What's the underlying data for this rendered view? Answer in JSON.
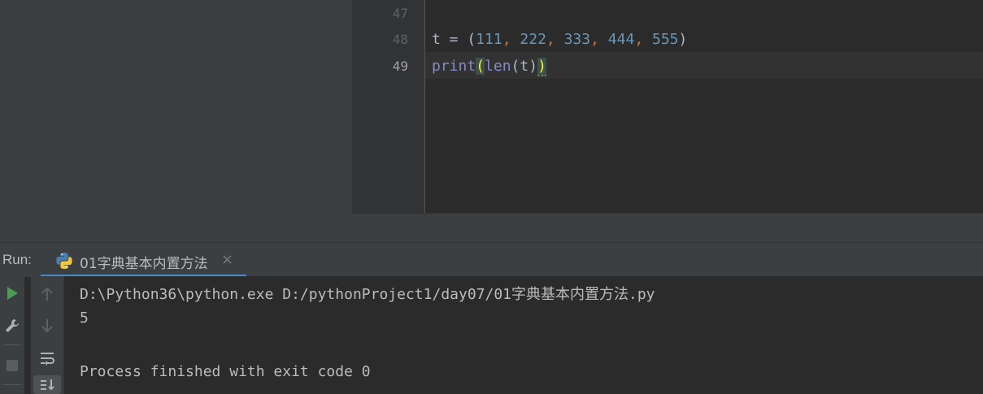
{
  "editor": {
    "lines": [
      {
        "num": "47",
        "code": ""
      },
      {
        "num": "48",
        "code": "t = (111, 222, 333, 444, 555)"
      },
      {
        "num": "49",
        "code": "print(len(t))"
      }
    ],
    "line48_tokens": {
      "var": "t = (",
      "n1": "111",
      "n2": "222",
      "n3": "333",
      "n4": "444",
      "n5": "555",
      "comma": ",",
      "close": ")"
    },
    "line49_tokens": {
      "print": "print",
      "open": "(",
      "len": "len",
      "inner": "(t)",
      "close": ")"
    }
  },
  "run_panel": {
    "label": "Run:",
    "tab_label": "01字典基本内置方法",
    "close": "×"
  },
  "console": {
    "lines": [
      "D:\\Python36\\python.exe D:/pythonProject1/day07/01字典基本内置方法.py",
      "5",
      "",
      "Process finished with exit code 0"
    ]
  },
  "icons": {
    "run": "play-icon",
    "wrench": "wrench-icon",
    "stop": "stop-icon",
    "up": "arrow-up-icon",
    "down": "arrow-down-icon",
    "wrap": "soft-wrap-icon",
    "scroll": "scroll-to-end-icon",
    "python": "python-icon"
  },
  "colors": {
    "accent": "#4a88c7",
    "number": "#6897bb",
    "keyword": "#cc7832",
    "builtin": "#8888c6",
    "run_green": "#499c54"
  }
}
